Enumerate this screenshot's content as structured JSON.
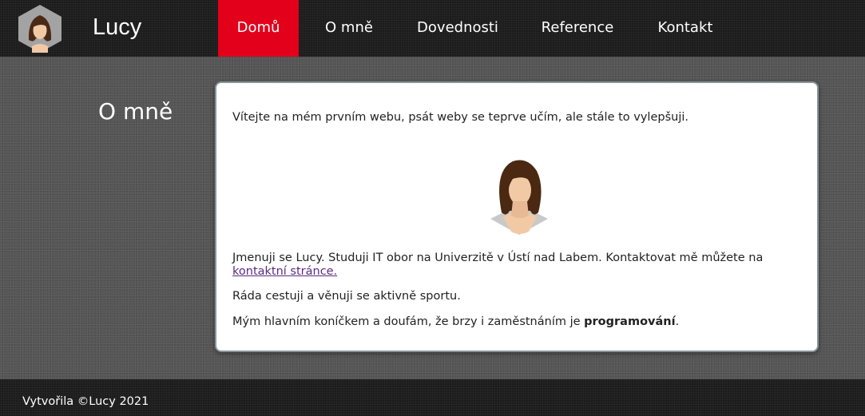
{
  "header": {
    "site_name": "Lucy",
    "nav": [
      {
        "label": "Domů",
        "active": true
      },
      {
        "label": "O mně",
        "active": false
      },
      {
        "label": "Dovednosti",
        "active": false
      },
      {
        "label": "Reference",
        "active": false
      },
      {
        "label": "Kontakt",
        "active": false
      }
    ],
    "accent_color": "#e3001b"
  },
  "main": {
    "section_title": "O mně",
    "intro": "Vítejte na mém prvním webu, psát weby se teprve učím, ale stále to vylepšuji.",
    "avatar_icon": "woman-avatar-icon",
    "bio_text": "Jmenuji se Lucy. Studuji IT obor na Univerzitě v Ústí nad Labem. Kontaktovat mě můžete na",
    "contact_link": "kontaktní stránce.",
    "hobby": "Ráda cestuji a věnuji se aktivně sportu.",
    "main_hobby_prefix": "Mým hlavním koníčkem a doufám, že brzy i zaměstnáním je",
    "main_hobby_bold": "programování",
    "main_hobby_suffix": "."
  },
  "footer": {
    "text": "Vytvořila ©Lucy 2021"
  }
}
